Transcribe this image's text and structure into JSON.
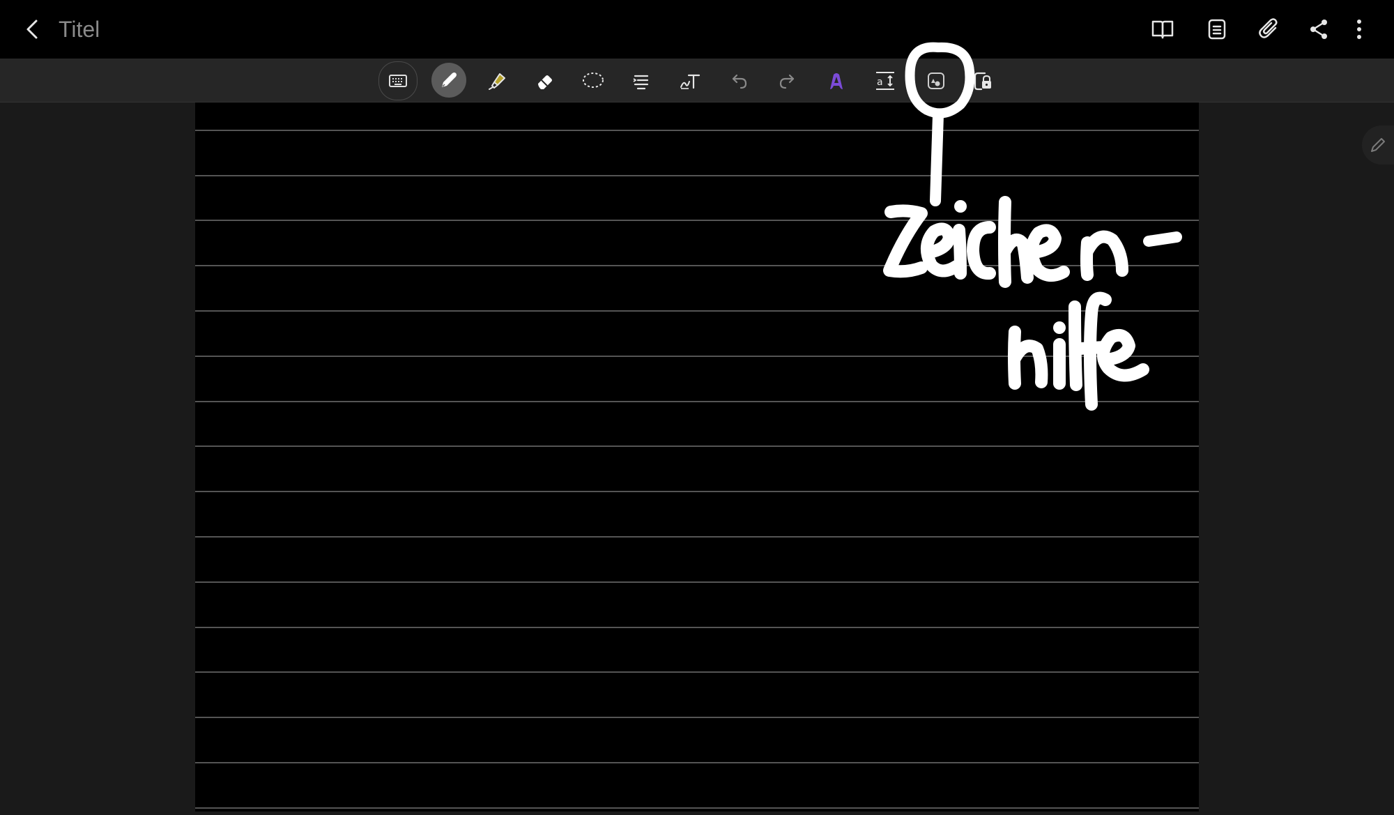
{
  "appbar": {
    "title": "Titel",
    "actions": [
      {
        "name": "book-view-icon"
      },
      {
        "name": "page-list-icon"
      },
      {
        "name": "attachment-icon"
      },
      {
        "name": "share-icon"
      },
      {
        "name": "more-options-icon"
      }
    ]
  },
  "toolbar": {
    "tools": [
      {
        "name": "keyboard-icon"
      },
      {
        "name": "pen-icon",
        "active": true
      },
      {
        "name": "highlighter-icon"
      },
      {
        "name": "eraser-icon"
      },
      {
        "name": "lasso-select-icon"
      },
      {
        "name": "text-format-icon"
      },
      {
        "name": "handwriting-to-text-icon"
      },
      {
        "name": "undo-icon"
      },
      {
        "name": "redo-icon"
      },
      {
        "name": "ai-assist-icon"
      },
      {
        "name": "text-spacing-icon"
      },
      {
        "name": "drawing-assist-icon"
      },
      {
        "name": "read-only-lock-icon"
      }
    ],
    "colors": {
      "highlighter": "#b5a22a",
      "ai_assist": "#7b4bd8"
    }
  },
  "annotation": {
    "handwritten_text": "zeichen-hilfe"
  }
}
